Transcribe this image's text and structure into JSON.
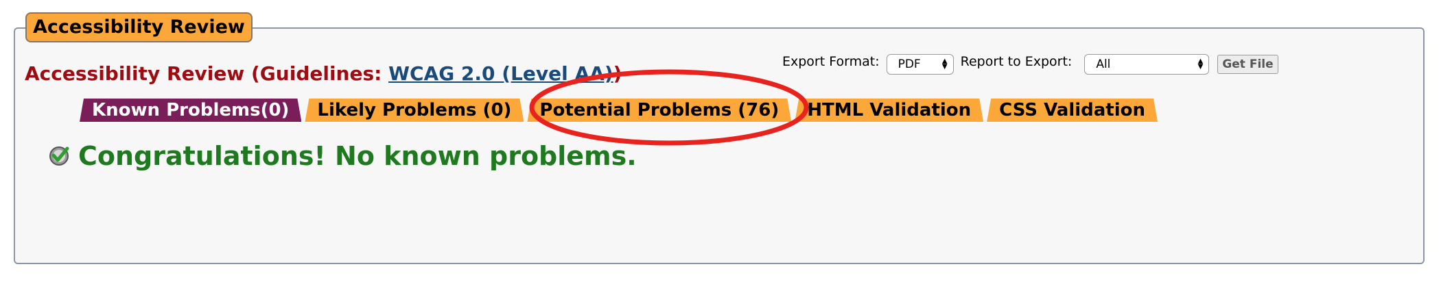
{
  "panel": {
    "legend": "Accessibility Review",
    "heading_prefix": "Accessibility Review (Guidelines: ",
    "guideline_link": "WCAG 2.0 (Level AA)",
    "heading_suffix": ")"
  },
  "export": {
    "format_label": "Export Format:",
    "format_value": "PDF",
    "report_label": "Report to Export:",
    "report_value": "All",
    "get_file_label": "Get File"
  },
  "tabs": [
    {
      "label": "Known Problems(0)",
      "active": true
    },
    {
      "label": "Likely Problems (0)",
      "active": false
    },
    {
      "label": "Potential Problems (76)",
      "active": false
    },
    {
      "label": "HTML Validation",
      "active": false
    },
    {
      "label": "CSS Validation",
      "active": false
    }
  ],
  "result": {
    "message": "Congratulations! No known problems."
  },
  "colors": {
    "tab_active": "#7a1e5a",
    "tab_inactive": "#fca73a",
    "heading": "#9b0d12",
    "link": "#1a4a7a",
    "success": "#1f7a1f",
    "annotation": "#e8231e"
  }
}
